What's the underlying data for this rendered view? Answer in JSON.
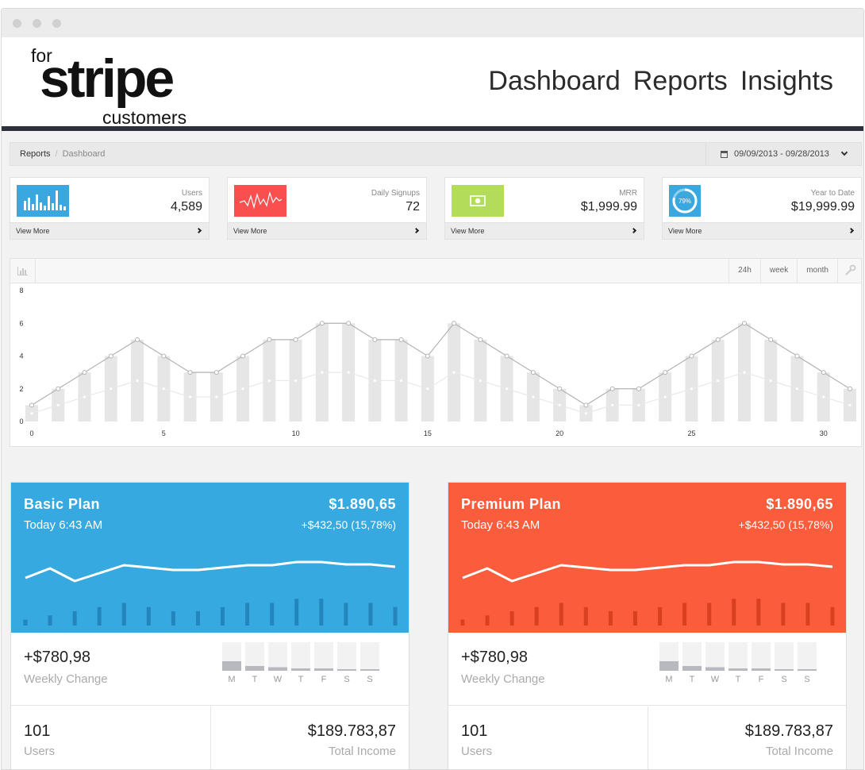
{
  "header": {
    "logo": {
      "pre": "for",
      "main": "stripe",
      "post": "customers"
    },
    "nav": [
      "Dashboard",
      "Reports",
      "Insights"
    ]
  },
  "breadcrumb": {
    "root": "Reports",
    "current": "Dashboard"
  },
  "date_range": "09/09/2013 - 09/28/2013",
  "stats": [
    {
      "label": "Users",
      "value": "4,589",
      "link": "View More",
      "color": "#3aa7df",
      "icon": "bar-chart-icon"
    },
    {
      "label": "Daily Signups",
      "value": "72",
      "link": "View More",
      "color": "#f94f4f",
      "icon": "pulse-icon"
    },
    {
      "label": "MRR",
      "value": "$1,999.99",
      "link": "View More",
      "color": "#b4dc5b",
      "icon": "money-icon"
    },
    {
      "label": "Year to Date",
      "value": "$19,999.99",
      "link": "View More",
      "color": "#3aa7df",
      "icon": "progress-ring-icon",
      "progress_percent": "79%"
    }
  ],
  "chart_controls": [
    "24h",
    "week",
    "month"
  ],
  "chart_data": {
    "type": "bar",
    "x": [
      0,
      1,
      2,
      3,
      4,
      5,
      6,
      7,
      8,
      9,
      10,
      11,
      12,
      13,
      14,
      15,
      16,
      17,
      18,
      19,
      20,
      21,
      22,
      23,
      24,
      25,
      26,
      27,
      28,
      29,
      30,
      31
    ],
    "x_ticks": [
      0,
      5,
      10,
      15,
      20,
      25,
      30
    ],
    "ylim": [
      0,
      8
    ],
    "y_ticks": [
      0,
      2,
      4,
      6,
      8
    ],
    "series": [
      {
        "kind": "bar",
        "values": [
          1,
          2,
          3,
          4,
          5,
          4,
          3,
          3,
          4,
          5,
          5,
          6,
          6,
          5,
          5,
          4,
          6,
          5,
          4,
          3,
          2,
          1,
          2,
          2,
          3,
          4,
          5,
          6,
          5,
          4,
          3,
          2
        ]
      },
      {
        "kind": "line",
        "values": [
          1,
          2,
          3,
          4,
          5,
          4,
          3,
          3,
          4,
          5,
          5,
          6,
          6,
          5,
          5,
          4,
          6,
          5,
          4,
          3,
          2,
          1,
          2,
          2,
          3,
          4,
          5,
          6,
          5,
          4,
          3,
          2
        ]
      },
      {
        "kind": "line",
        "values": [
          0.5,
          1,
          1.5,
          2,
          2.5,
          2,
          1.5,
          1.5,
          2,
          2.5,
          2.5,
          3,
          3,
          2.5,
          2.5,
          2,
          3,
          2.5,
          2,
          1.5,
          1,
          0.5,
          1,
          1,
          1.5,
          2,
          2.5,
          3,
          2.5,
          2,
          1.5,
          1
        ]
      }
    ]
  },
  "plans": [
    {
      "name": "Basic Plan",
      "time": "Today 6:43 AM",
      "amount": "$1.890,65",
      "delta": "+$432,50 (15,78%)",
      "color": "#36a9e1",
      "bar_color": "#2485bd",
      "weekly_value": "+$780,98",
      "weekly_label": "Weekly Change",
      "days": [
        "M",
        "T",
        "W",
        "T",
        "F",
        "S",
        "S"
      ],
      "day_levels": [
        0.4,
        0.2,
        0.15,
        0.1,
        0.1,
        0.04,
        0.04
      ],
      "users_value": "101",
      "users_label": "Users",
      "income_value": "$189.783,87",
      "income_label": "Total Income",
      "line": [
        3.0,
        4.2,
        2.6,
        3.6,
        4.6,
        4.3,
        4.0,
        4.0,
        4.3,
        4.6,
        4.6,
        5.0,
        5.0,
        4.7,
        4.7,
        4.4
      ],
      "bars": [
        0.1,
        0.17,
        0.24,
        0.31,
        0.38,
        0.31,
        0.24,
        0.24,
        0.31,
        0.38,
        0.38,
        0.45,
        0.45,
        0.38,
        0.38,
        0.31
      ]
    },
    {
      "name": "Premium Plan",
      "time": "Today 6:43 AM",
      "amount": "$1.890,65",
      "delta": "+$432,50 (15,78%)",
      "color": "#fa5c3c",
      "bar_color": "#d9401f",
      "weekly_value": "+$780,98",
      "weekly_label": "Weekly Change",
      "days": [
        "M",
        "T",
        "W",
        "T",
        "F",
        "S",
        "S"
      ],
      "day_levels": [
        0.4,
        0.2,
        0.15,
        0.1,
        0.1,
        0.04,
        0.04
      ],
      "users_value": "101",
      "users_label": "Users",
      "income_value": "$189.783,87",
      "income_label": "Total Income",
      "line": [
        3.0,
        4.2,
        2.6,
        3.6,
        4.6,
        4.3,
        4.0,
        4.0,
        4.3,
        4.6,
        4.6,
        5.0,
        5.0,
        4.7,
        4.7,
        4.4
      ],
      "bars": [
        0.1,
        0.17,
        0.24,
        0.31,
        0.38,
        0.31,
        0.24,
        0.24,
        0.31,
        0.38,
        0.38,
        0.45,
        0.45,
        0.38,
        0.38,
        0.31
      ]
    }
  ]
}
